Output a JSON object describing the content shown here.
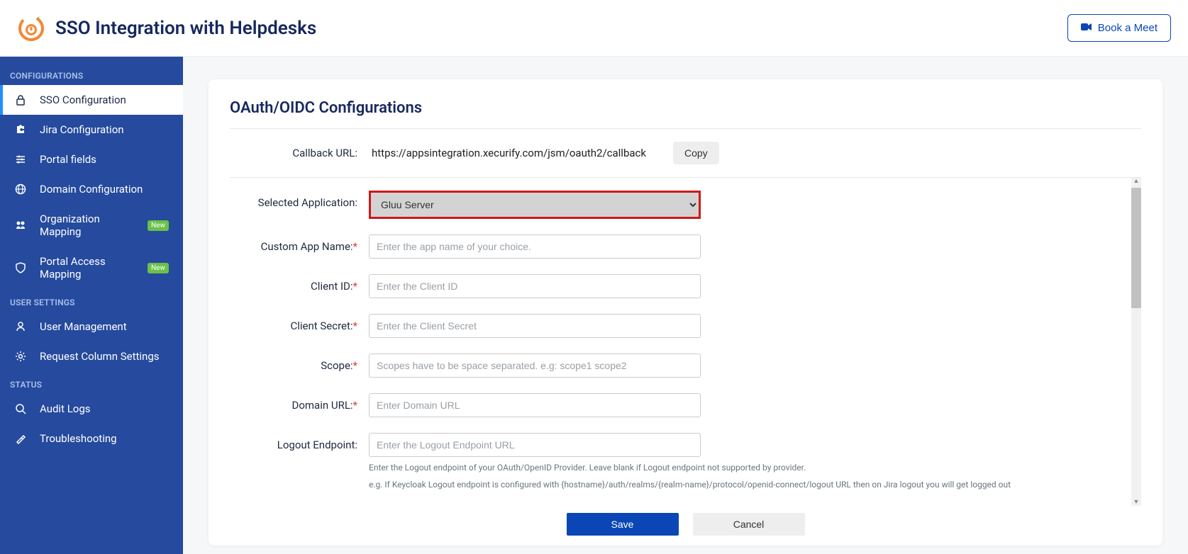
{
  "header": {
    "title": "SSO Integration with Helpdesks",
    "book_meet": "Book a Meet"
  },
  "sidebar": {
    "sections": {
      "configurations": "CONFIGURATIONS",
      "user_settings": "USER SETTINGS",
      "status": "STATUS"
    },
    "items": {
      "sso_config": "SSO Configuration",
      "jira_config": "Jira Configuration",
      "portal_fields": "Portal fields",
      "domain_config": "Domain Configuration",
      "org_mapping": "Organization Mapping",
      "portal_access": "Portal Access Mapping",
      "user_mgmt": "User Management",
      "request_col": "Request Column Settings",
      "audit_logs": "Audit Logs",
      "troubleshooting": "Troubleshooting"
    },
    "badge_new": "New"
  },
  "panel": {
    "title": "OAuth/OIDC Configurations",
    "callback": {
      "label": "Callback URL:",
      "url": "https://appsintegration.xecurify.com/jsm/oauth2/callback",
      "copy": "Copy"
    },
    "fields": {
      "selected_app": {
        "label": "Selected Application:",
        "value": "Gluu Server"
      },
      "custom_app": {
        "label": "Custom App Name:",
        "placeholder": "Enter the app name of your choice."
      },
      "client_id": {
        "label": "Client ID:",
        "placeholder": "Enter the Client ID"
      },
      "client_secret": {
        "label": "Client Secret:",
        "placeholder": "Enter the Client Secret"
      },
      "scope": {
        "label": "Scope:",
        "placeholder": "Scopes have to be space separated. e.g: scope1 scope2"
      },
      "domain_url": {
        "label": "Domain URL:",
        "placeholder": "Enter Domain URL"
      },
      "logout_ep": {
        "label": "Logout Endpoint:",
        "placeholder": "Enter the Logout Endpoint URL",
        "helper1": "Enter the Logout endpoint of your OAuth/OpenID Provider. Leave blank if Logout endpoint not supported by provider.",
        "helper2": "e.g. If Keycloak Logout endpoint is configured with {hostname}/auth/realms/{realm-name}/protocol/openid-connect/logout URL then on Jira logout you will get logged out"
      }
    },
    "actions": {
      "save": "Save",
      "cancel": "Cancel"
    }
  }
}
